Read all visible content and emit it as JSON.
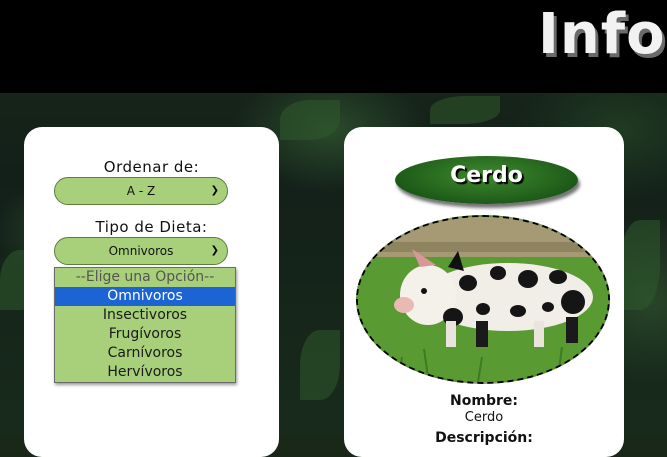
{
  "header": {
    "title": "Info"
  },
  "filters": {
    "sort_label": "Ordenar de:",
    "sort_value": "A - Z",
    "diet_label": "Tipo de Dieta:",
    "diet_value": "Omnivoros",
    "diet_options": [
      {
        "label": "--Elige una Opción--",
        "selected": false
      },
      {
        "label": "Omnivoros",
        "selected": true
      },
      {
        "label": "Insectivoros",
        "selected": false
      },
      {
        "label": "Frugívoros",
        "selected": false
      },
      {
        "label": "Carnívoros",
        "selected": false
      },
      {
        "label": "Hervívoros",
        "selected": false
      }
    ]
  },
  "card": {
    "name_badge": "Cerdo",
    "image_icon": "pig-photo",
    "name_label": "Nombre:",
    "name_value": "Cerdo",
    "description_label": "Descripción:"
  },
  "colors": {
    "select_bg": "#a8d07a",
    "highlight": "#1c64d4",
    "badge": "#2e6e24"
  }
}
